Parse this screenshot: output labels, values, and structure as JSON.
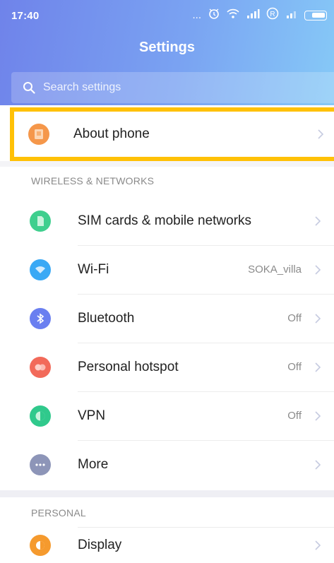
{
  "status_bar": {
    "time": "17:40",
    "dots": "...",
    "r_badge": "R"
  },
  "header": {
    "title": "Settings"
  },
  "search": {
    "placeholder": "Search settings"
  },
  "about": {
    "label": "About phone",
    "icon": "phone-info-icon",
    "color": "#f5974a"
  },
  "sections": [
    {
      "title": "WIRELESS & NETWORKS",
      "items": [
        {
          "label": "SIM cards & mobile networks",
          "value": "",
          "icon": "sim-card-icon",
          "color": "#3fcf8e"
        },
        {
          "label": "Wi-Fi",
          "value": "SOKA_villa",
          "icon": "wifi-icon",
          "color": "#3aa9f5"
        },
        {
          "label": "Bluetooth",
          "value": "Off",
          "icon": "bluetooth-icon",
          "color": "#6a7ff0"
        },
        {
          "label": "Personal hotspot",
          "value": "Off",
          "icon": "hotspot-icon",
          "color": "#f26a5a"
        },
        {
          "label": "VPN",
          "value": "Off",
          "icon": "vpn-icon",
          "color": "#30c98c"
        },
        {
          "label": "More",
          "value": "",
          "icon": "more-icon",
          "color": "#8d95b8"
        }
      ]
    },
    {
      "title": "PERSONAL",
      "items": [
        {
          "label": "Display",
          "value": "",
          "icon": "display-icon",
          "color": "#f59a2e"
        }
      ]
    }
  ],
  "colors": {
    "accent": "#7a96ee",
    "highlight": "#ffc107",
    "chevron": "#c6cbe0"
  }
}
